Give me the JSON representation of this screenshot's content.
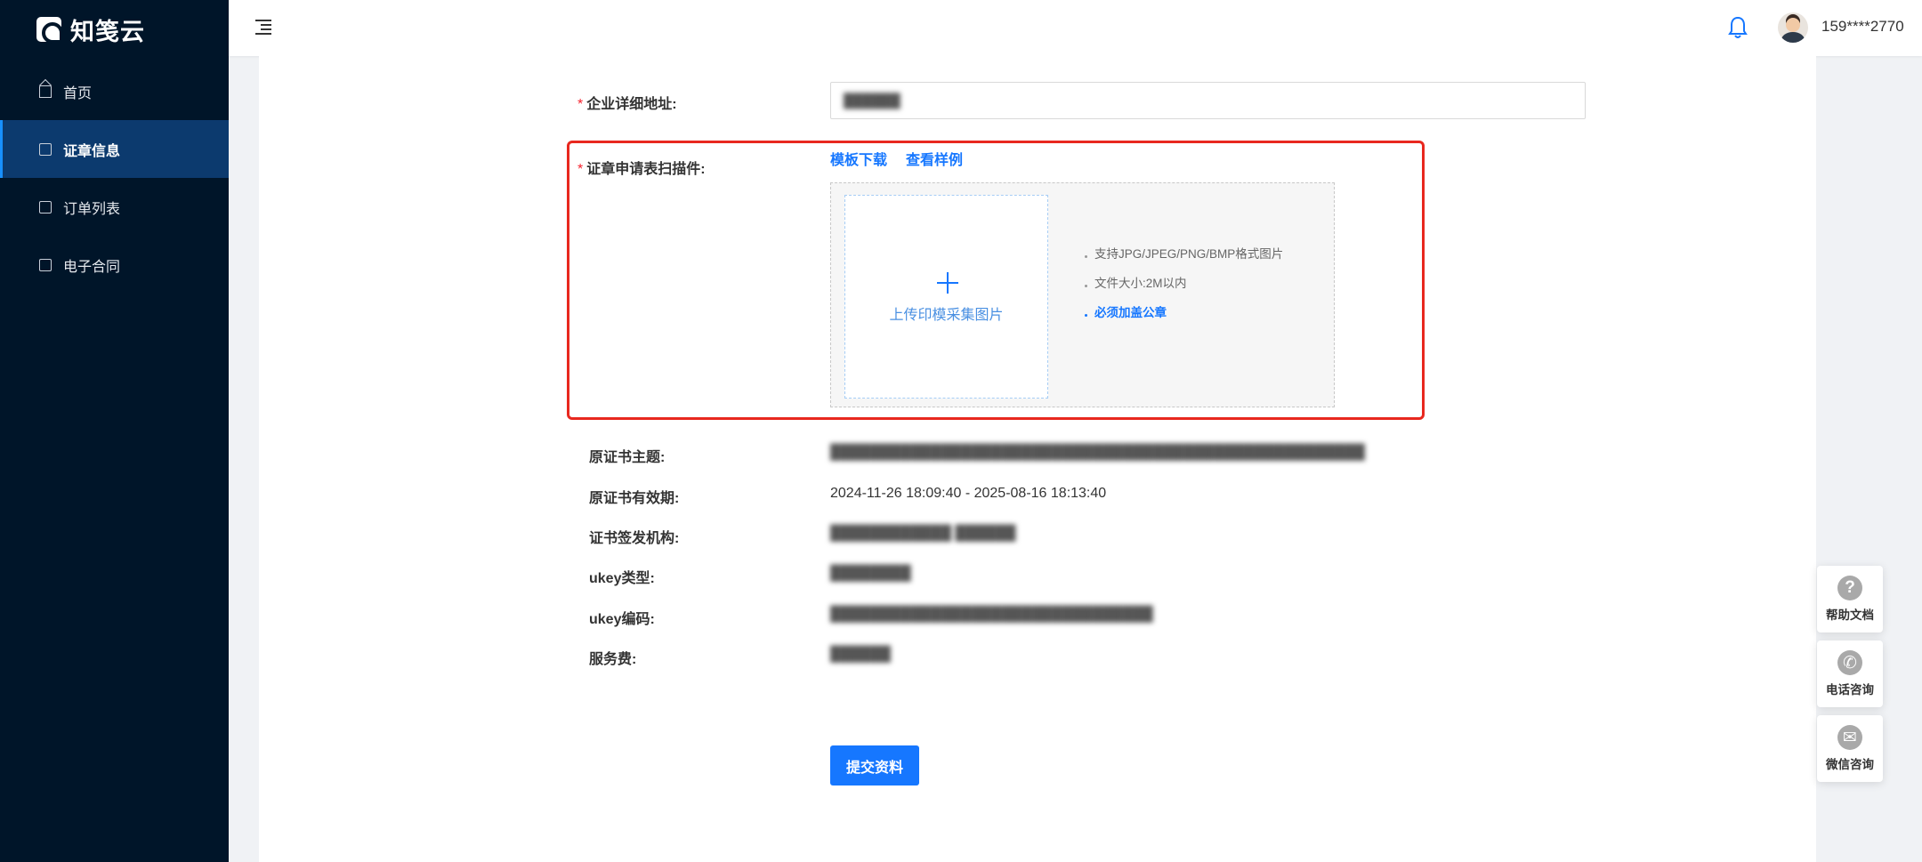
{
  "app": {
    "logo_text": "知笺云"
  },
  "sidebar": {
    "items": [
      {
        "label": "首页",
        "icon": "home-icon"
      },
      {
        "label": "证章信息",
        "icon": "calendar-icon",
        "active": true
      },
      {
        "label": "订单列表",
        "icon": "list-icon"
      },
      {
        "label": "电子合同",
        "icon": "contract-icon"
      }
    ]
  },
  "header": {
    "username": "159****2770"
  },
  "form": {
    "address": {
      "label": "企业详细地址:",
      "value": "██████"
    },
    "scan": {
      "label": "证章申请表扫描件:",
      "template_link": "模板下载",
      "sample_link": "查看样例",
      "upload_text": "上传印模采集图片",
      "tips": [
        "支持JPG/JPEG/PNG/BMP格式图片",
        "文件大小:2M以内",
        "必须加盖公章"
      ]
    },
    "fields": [
      {
        "label": "原证书主题:",
        "value": "█████████████████████████████████████████████████████"
      },
      {
        "label": "原证书有效期:",
        "value": "2024-11-26 18:09:40 - 2025-08-16 18:13:40"
      },
      {
        "label": "证书签发机构:",
        "value": "████████████ ██████"
      },
      {
        "label": "ukey类型:",
        "value": "████████"
      },
      {
        "label": "ukey编码:",
        "value": "████████████████████████████████"
      },
      {
        "label": "服务费:",
        "value": "██████"
      }
    ],
    "submit_label": "提交资料"
  },
  "float_buttons": [
    {
      "label": "帮助文档",
      "icon": "help-icon",
      "glyph": "?"
    },
    {
      "label": "电话咨询",
      "icon": "phone-icon",
      "glyph": "✆"
    },
    {
      "label": "微信咨询",
      "icon": "wechat-icon",
      "glyph": "✉"
    }
  ],
  "colors": {
    "sidebar_bg": "#001529",
    "active_item": "#0c3a6e",
    "primary": "#1677ff",
    "highlight": "#e8281f"
  }
}
